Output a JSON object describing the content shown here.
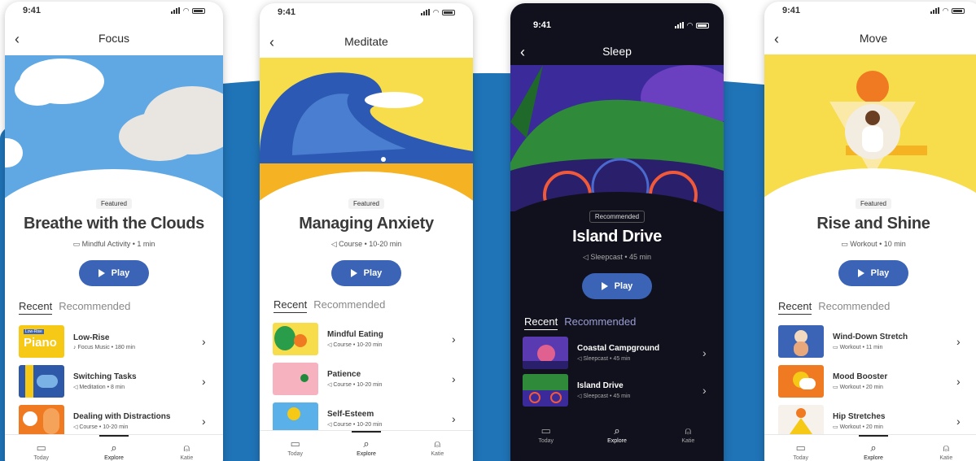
{
  "status": {
    "time": "9:41"
  },
  "screens": [
    {
      "title": "Focus",
      "badge": "Featured",
      "feature_title": "Breathe with the Clouds",
      "feature_meta": "Mindful Activity • 1 min",
      "play": "Play",
      "tabs": [
        "Recent",
        "Recommended"
      ],
      "items": [
        {
          "title": "Low-Rise",
          "meta": "Focus Music • 180 min",
          "thumb_text_small": "Low-Rise",
          "thumb_text": "Piano"
        },
        {
          "title": "Switching Tasks",
          "meta": "Meditation • 8 min"
        },
        {
          "title": "Dealing with Distractions",
          "meta": "Course • 10-20 min"
        }
      ]
    },
    {
      "title": "Meditate",
      "badge": "Featured",
      "feature_title": "Managing Anxiety",
      "feature_meta": "Course • 10-20 min",
      "play": "Play",
      "tabs": [
        "Recent",
        "Recommended"
      ],
      "items": [
        {
          "title": "Mindful Eating",
          "meta": "Course • 10-20 min"
        },
        {
          "title": "Patience",
          "meta": "Course • 10-20 min"
        },
        {
          "title": "Self-Esteem",
          "meta": "Course • 10-20 min"
        }
      ]
    },
    {
      "title": "Sleep",
      "badge": "Recommended",
      "feature_title": "Island Drive",
      "feature_meta": "Sleepcast • 45 min",
      "play": "Play",
      "tabs": [
        "Recent",
        "Recommended"
      ],
      "items": [
        {
          "title": "Coastal Campground",
          "meta": "Sleepcast • 45 min"
        },
        {
          "title": "Island Drive",
          "meta": "Sleepcast • 45 min"
        }
      ]
    },
    {
      "title": "Move",
      "badge": "Featured",
      "feature_title": "Rise and Shine",
      "feature_meta": "Workout • 10 min",
      "play": "Play",
      "tabs": [
        "Recent",
        "Recommended"
      ],
      "items": [
        {
          "title": "Wind-Down Stretch",
          "meta": "Workout • 11 min"
        },
        {
          "title": "Mood Booster",
          "meta": "Workout • 20 min"
        },
        {
          "title": "Hip Stretches",
          "meta": "Workout • 20 min"
        }
      ]
    }
  ],
  "tabbar": [
    "Today",
    "Explore",
    "Katie"
  ],
  "colors": {
    "accent": "#3b64b7",
    "background_band": "#1f73b7",
    "dark_bg": "#11111d"
  }
}
